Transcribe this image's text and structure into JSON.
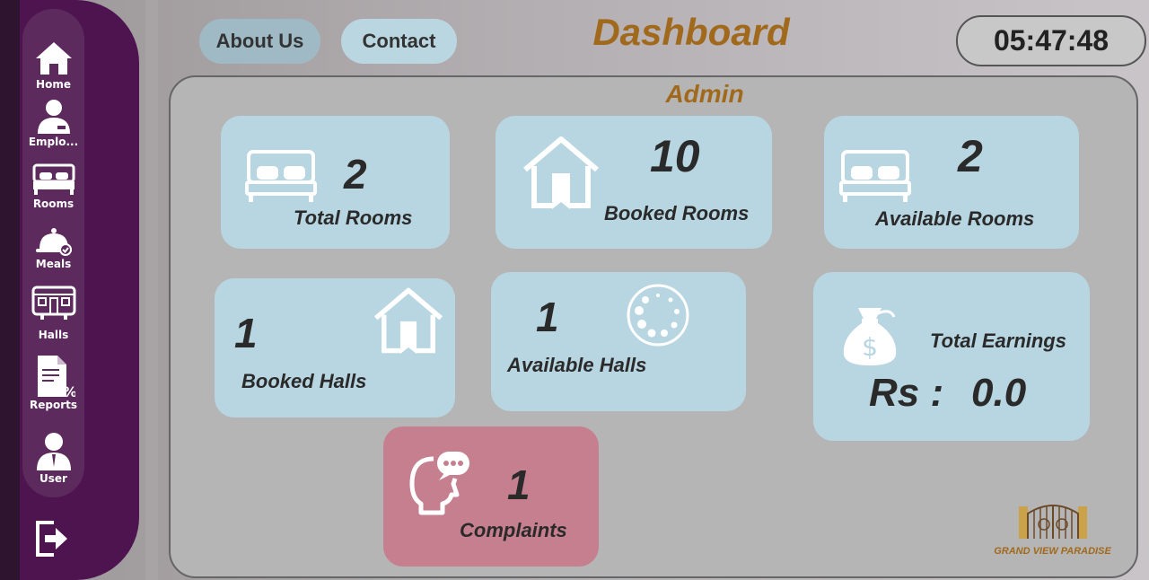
{
  "sidebar": {
    "items": [
      {
        "label": "Home",
        "icon": "home-icon"
      },
      {
        "label": "Emplo...",
        "icon": "employee-icon"
      },
      {
        "label": "Rooms",
        "icon": "bed-icon"
      },
      {
        "label": "Meals",
        "icon": "meal-cloche-icon"
      },
      {
        "label": "Halls",
        "icon": "hall-icon"
      },
      {
        "label": "Reports",
        "icon": "report-icon"
      },
      {
        "label": "User",
        "icon": "user-icon"
      }
    ],
    "logout_icon": "logout-icon"
  },
  "header": {
    "about_label": "About Us",
    "contact_label": "Contact",
    "title": "Dashboard",
    "clock": "05:47:48"
  },
  "main": {
    "role": "Admin",
    "cards": {
      "total_rooms": {
        "value": "2",
        "label": "Total Rooms",
        "icon": "bed-icon"
      },
      "booked_rooms": {
        "value": "10",
        "label": "Booked Rooms",
        "icon": "house-icon"
      },
      "available_rooms": {
        "value": "2",
        "label": "Available Rooms",
        "icon": "bed-icon"
      },
      "booked_halls": {
        "value": "1",
        "label": "Booked Halls",
        "icon": "house-icon"
      },
      "available_halls": {
        "value": "1",
        "label": "Available Halls",
        "icon": "loading-circle-icon"
      },
      "total_earnings": {
        "label": "Total Earnings",
        "currency": "Rs :",
        "value": "0.0",
        "icon": "money-bag-icon"
      },
      "complaints": {
        "value": "1",
        "label": "Complaints",
        "icon": "complaint-head-icon"
      }
    },
    "brand": "GRAND VIEW PARADISE"
  },
  "colors": {
    "sidebar": "#4e1450",
    "card": "#b8d6e1",
    "complaint_card": "#c67f8f",
    "accent_text": "#a1691b"
  }
}
